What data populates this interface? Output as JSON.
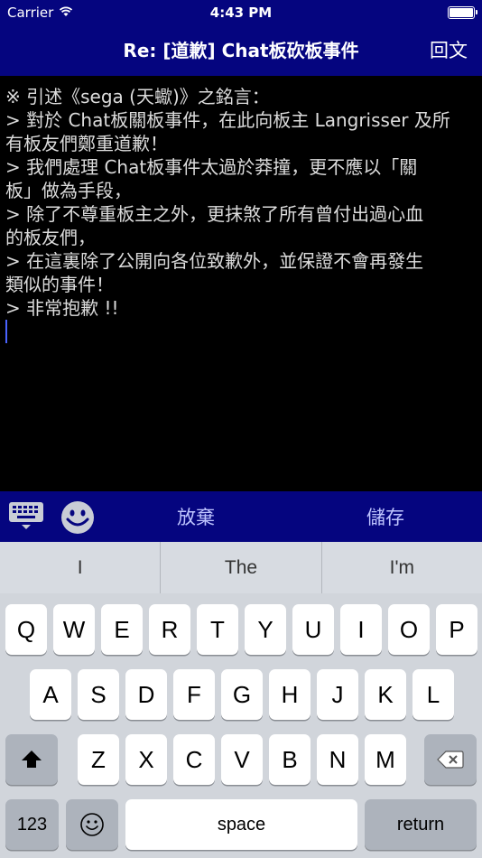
{
  "status": {
    "carrier": "Carrier",
    "time": "4:43 PM"
  },
  "nav": {
    "title": "Re: [道歉] Chat板砍板事件",
    "reply_label": "回文"
  },
  "editor": {
    "lines": [
      "※ 引述《sega (天蠍)》之銘言：",
      "> 對於 Chat板關板事件，在此向板主 Langrisser 及所",
      "有板友們鄭重道歉！",
      "> 我們處理 Chat板事件太過於莽撞，更不應以「關",
      "板」做為手段，",
      "> 除了不尊重板主之外，更抹煞了所有曾付出過心血",
      "的板友們，",
      "> 在這裏除了公開向各位致歉外，並保證不會再發生",
      "類似的事件！",
      "> 非常抱歉 !!"
    ]
  },
  "toolbar": {
    "abandon_label": "放棄",
    "save_label": "儲存"
  },
  "keyboard": {
    "suggestions": [
      "I",
      "The",
      "I'm"
    ],
    "row1": [
      "Q",
      "W",
      "E",
      "R",
      "T",
      "Y",
      "U",
      "I",
      "O",
      "P"
    ],
    "row2": [
      "A",
      "S",
      "D",
      "F",
      "G",
      "H",
      "J",
      "K",
      "L"
    ],
    "row3": [
      "Z",
      "X",
      "C",
      "V",
      "B",
      "N",
      "M"
    ],
    "numbers_label": "123",
    "space_label": "space",
    "return_label": "return"
  },
  "colors": {
    "bar": "#05057f",
    "editor_bg": "#000000",
    "text": "#dcdcdc",
    "cursor": "#4a63ff",
    "toolbar_text": "#bfc5ff"
  }
}
